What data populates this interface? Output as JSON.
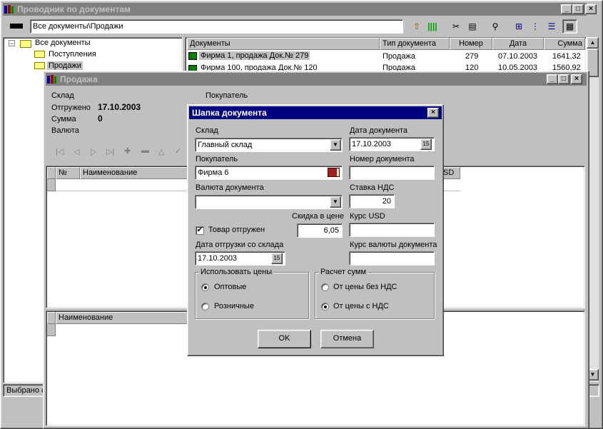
{
  "main_window": {
    "title": "Проводник по документам",
    "path": "Все документы\\Продажи",
    "status": "Выбрано с"
  },
  "tree": {
    "root": "Все документы",
    "items": [
      "Поступления",
      "Продажи"
    ]
  },
  "doc_list": {
    "headers": [
      "Документы",
      "Тип документа",
      "Номер",
      "Дата",
      "Сумма"
    ],
    "rows": [
      {
        "doc": "Фирма 1, продажа Док.№ 279",
        "type": "Продажа",
        "number": "279",
        "date": "07.10.2003",
        "sum": "1641,32"
      },
      {
        "doc": "Фирма 100, продажа Док.№ 120",
        "type": "Продажа",
        "number": "120",
        "date": "10.05.2003",
        "sum": "1560,92"
      }
    ]
  },
  "sale_window": {
    "title": "Продажа",
    "warehouse_label": "Склад",
    "buyer_label": "Покупатель",
    "shipped_label": "Отгружено",
    "shipped_value": "17.10.2003",
    "sum_label": "Сумма",
    "sum_value": "0",
    "currency_label": "Валюта",
    "grid1_headers": [
      "№",
      "Наименование"
    ],
    "grid1_partial_header": "SD",
    "grid2_header": "Наименование"
  },
  "dialog": {
    "title": "Шапка документа",
    "warehouse_label": "Склад",
    "warehouse_value": "Главный склад",
    "doc_date_label": "Дата документа",
    "doc_date_value": "17.10.2003",
    "buyer_label": "Покупатель",
    "buyer_value": "Фирма 6",
    "doc_number_label": "Номер документа",
    "doc_number_value": "",
    "currency_label": "Валюта документа",
    "currency_value": "",
    "vat_label": "Ставка НДС",
    "vat_value": "20",
    "discount_label": "Скидка в цене",
    "discount_value": "6,05",
    "usd_label": "Курс USD",
    "usd_value": "",
    "shipped_label": "Товар отгружен",
    "shipped_checked": true,
    "ship_date_label": "Дата отгрузки со склада",
    "ship_date_value": "17.10.2003",
    "doc_rate_label": "Курс валюты документа",
    "doc_rate_value": "",
    "prices_group": "Использовать цены",
    "price_wholesale": "Оптовые",
    "price_retail": "Розничные",
    "calc_group": "Расчет сумм",
    "calc_no_vat": "От цены без НДС",
    "calc_with_vat": "От цены с НДС",
    "calendar_icon_text": "15",
    "ok": "OK",
    "cancel": "Отмена"
  },
  "colors": {
    "active_title": "#000080",
    "inactive_title": "#808080",
    "face": "#c0c0c0"
  }
}
